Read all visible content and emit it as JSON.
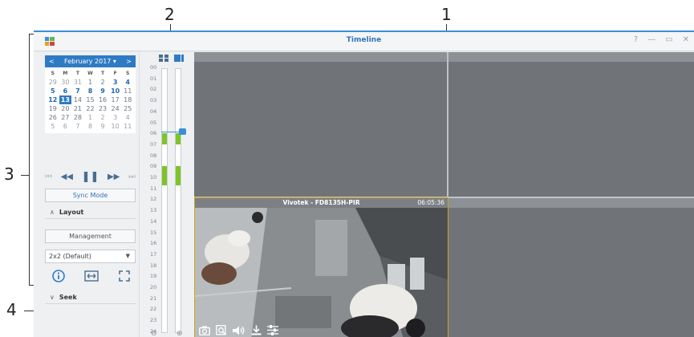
{
  "callouts": [
    "1",
    "2",
    "3",
    "4"
  ],
  "window": {
    "title": "Timeline",
    "controls": [
      "?",
      "—",
      "▭",
      "✕"
    ]
  },
  "calendar": {
    "prev": "<",
    "month_label": "February 2017 ▾",
    "next": ">",
    "weekdays": [
      "S",
      "M",
      "T",
      "W",
      "T",
      "F",
      "S"
    ],
    "weeks": [
      [
        {
          "d": "29",
          "s": "dim"
        },
        {
          "d": "30",
          "s": "dim"
        },
        {
          "d": "31",
          "s": "dim"
        },
        {
          "d": "1",
          "s": ""
        },
        {
          "d": "2",
          "s": ""
        },
        {
          "d": "3",
          "s": "rec"
        },
        {
          "d": "4",
          "s": "rec"
        }
      ],
      [
        {
          "d": "5",
          "s": "rec"
        },
        {
          "d": "6",
          "s": "rec"
        },
        {
          "d": "7",
          "s": "rec"
        },
        {
          "d": "8",
          "s": "rec"
        },
        {
          "d": "9",
          "s": "rec"
        },
        {
          "d": "10",
          "s": "rec"
        },
        {
          "d": "11",
          "s": ""
        }
      ],
      [
        {
          "d": "12",
          "s": "rec"
        },
        {
          "d": "13",
          "s": "sel"
        },
        {
          "d": "14",
          "s": ""
        },
        {
          "d": "15",
          "s": ""
        },
        {
          "d": "16",
          "s": ""
        },
        {
          "d": "17",
          "s": ""
        },
        {
          "d": "18",
          "s": ""
        }
      ],
      [
        {
          "d": "19",
          "s": ""
        },
        {
          "d": "20",
          "s": ""
        },
        {
          "d": "21",
          "s": ""
        },
        {
          "d": "22",
          "s": ""
        },
        {
          "d": "23",
          "s": ""
        },
        {
          "d": "24",
          "s": ""
        },
        {
          "d": "25",
          "s": ""
        }
      ],
      [
        {
          "d": "26",
          "s": ""
        },
        {
          "d": "27",
          "s": ""
        },
        {
          "d": "28",
          "s": ""
        },
        {
          "d": "1",
          "s": "dim"
        },
        {
          "d": "2",
          "s": "dim"
        },
        {
          "d": "3",
          "s": "dim"
        },
        {
          "d": "4",
          "s": "dim"
        }
      ],
      [
        {
          "d": "5",
          "s": "dim"
        },
        {
          "d": "6",
          "s": "dim"
        },
        {
          "d": "7",
          "s": "dim"
        },
        {
          "d": "8",
          "s": "dim"
        },
        {
          "d": "9",
          "s": "dim"
        },
        {
          "d": "10",
          "s": "dim"
        },
        {
          "d": "11",
          "s": "dim"
        }
      ]
    ]
  },
  "playback": {
    "skip_back": "⏮",
    "rewind": "◀◀",
    "pause": "❚❚",
    "forward": "▶▶",
    "skip_forward": "⏭"
  },
  "sync_mode_label": "Sync Mode",
  "layout_section": {
    "chevron": "∧",
    "label": "Layout",
    "management_label": "Management",
    "layout_select": "2x2 (Default)",
    "select_arrow": "▼"
  },
  "seek_section": {
    "chevron": "∨",
    "label": "Seek"
  },
  "timeline": {
    "hours": [
      "00",
      "01",
      "02",
      "03",
      "04",
      "05",
      "06",
      "07",
      "08",
      "09",
      "10",
      "11",
      "12",
      "13",
      "14",
      "15",
      "16",
      "17",
      "18",
      "19",
      "20",
      "21",
      "22",
      "23",
      "24"
    ],
    "zoom_out": "⊖",
    "zoom_in": "⊕"
  },
  "camera": {
    "name": "Vivotek - FD8135H-PIR",
    "time": "06:05:36"
  },
  "colors": {
    "accent": "#2e7bc4",
    "record": "#7fc32a",
    "active_border": "#d4a21a"
  }
}
